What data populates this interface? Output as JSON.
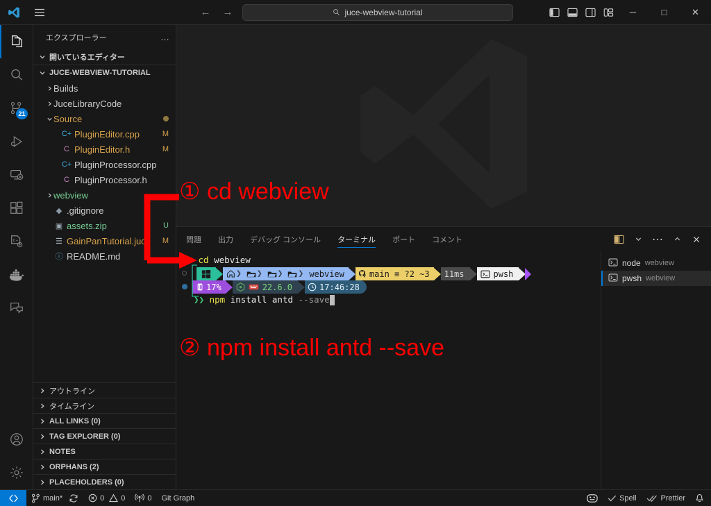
{
  "titlebar": {
    "logo_icon": "vscode-logo",
    "menu_icon": "hamburger-menu-icon",
    "back_icon": "←",
    "forward_icon": "→",
    "search_placeholder": "juce-webview-tutorial",
    "search_value": "juce-webview-tutorial",
    "search_icon": "search-icon",
    "layout_icons": [
      "toggle-primary-sidebar-icon",
      "toggle-panel-icon",
      "toggle-secondary-sidebar-icon",
      "customize-layout-icon"
    ],
    "minimize": "─",
    "maximize": "□",
    "close": "✕"
  },
  "activitybar": {
    "items": [
      {
        "name": "explorer",
        "icon": "files-icon",
        "active": true,
        "badge": ""
      },
      {
        "name": "search",
        "icon": "search-icon",
        "active": false,
        "badge": ""
      },
      {
        "name": "source-control",
        "icon": "source-control-icon",
        "active": false,
        "badge": "21"
      },
      {
        "name": "run-and-debug",
        "icon": "run-debug-icon",
        "active": false,
        "badge": ""
      },
      {
        "name": "remote-explorer",
        "icon": "remote-explorer-icon",
        "active": false,
        "badge": ""
      },
      {
        "name": "extensions",
        "icon": "extensions-icon",
        "active": false,
        "badge": ""
      },
      {
        "name": "cpp-config",
        "icon": "cpp-gear-icon",
        "active": false,
        "badge": ""
      },
      {
        "name": "docker",
        "icon": "docker-whale-icon",
        "active": false,
        "badge": ""
      },
      {
        "name": "chat",
        "icon": "chat-bubble-icon",
        "active": false,
        "badge": ""
      }
    ],
    "bottom": [
      {
        "name": "accounts",
        "icon": "account-icon"
      },
      {
        "name": "settings",
        "icon": "gear-icon"
      }
    ]
  },
  "sidebar": {
    "title": "エクスプローラー",
    "more_actions": "…",
    "open_editors_label": "開いているエディター",
    "project_label": "JUCE-WEBVIEW-TUTORIAL",
    "tree": [
      {
        "label": "Builds",
        "type": "folder",
        "expanded": false,
        "indent": 1,
        "badge": "",
        "icon": "",
        "color": "#cccccc"
      },
      {
        "label": "JuceLibraryCode",
        "type": "folder",
        "expanded": false,
        "indent": 1,
        "badge": "",
        "icon": "",
        "color": "#cccccc"
      },
      {
        "label": "Source",
        "type": "folder",
        "expanded": true,
        "indent": 1,
        "badge": "dot",
        "icon": "",
        "color": "#d6a24a"
      },
      {
        "label": "PluginEditor.cpp",
        "type": "file",
        "expanded": false,
        "indent": 2,
        "badge": "M",
        "icon": "C+",
        "color": "#d6a24a",
        "iconcolor": "#38b1e0"
      },
      {
        "label": "PluginEditor.h",
        "type": "file",
        "expanded": false,
        "indent": 2,
        "badge": "M",
        "icon": "C",
        "color": "#d6a24a",
        "iconcolor": "#c586c0"
      },
      {
        "label": "PluginProcessor.cpp",
        "type": "file",
        "expanded": false,
        "indent": 2,
        "badge": "",
        "icon": "C+",
        "color": "#cccccc",
        "iconcolor": "#38b1e0"
      },
      {
        "label": "PluginProcessor.h",
        "type": "file",
        "expanded": false,
        "indent": 2,
        "badge": "",
        "icon": "C",
        "color": "#cccccc",
        "iconcolor": "#c586c0"
      },
      {
        "label": "webview",
        "type": "folder",
        "expanded": false,
        "indent": 1,
        "badge": "",
        "icon": "",
        "color": "#73c991"
      },
      {
        "label": ".gitignore",
        "type": "file",
        "expanded": false,
        "indent": 1,
        "badge": "",
        "icon": "◆",
        "color": "#cccccc",
        "iconcolor": "#8a9aa9"
      },
      {
        "label": "assets.zip",
        "type": "file",
        "expanded": false,
        "indent": 1,
        "badge": "U",
        "icon": "▣",
        "color": "#73c991",
        "iconcolor": "#9aa7b0"
      },
      {
        "label": "GainPanTutorial.juce",
        "type": "file",
        "expanded": false,
        "indent": 1,
        "badge": "M",
        "icon": "☰",
        "color": "#d6a24a",
        "iconcolor": "#a9b5bf"
      },
      {
        "label": "README.md",
        "type": "file",
        "expanded": false,
        "indent": 1,
        "badge": "",
        "icon": "ⓘ",
        "color": "#cccccc",
        "iconcolor": "#519aba"
      }
    ],
    "bottom_sections": [
      {
        "label": "アウトライン",
        "bold": false
      },
      {
        "label": "タイムライン",
        "bold": false
      },
      {
        "label": "ALL LINKS (0)",
        "bold": true
      },
      {
        "label": "TAG EXPLORER (0)",
        "bold": true
      },
      {
        "label": "NOTES",
        "bold": true
      },
      {
        "label": "ORPHANS (2)",
        "bold": true
      },
      {
        "label": "PLACEHOLDERS (0)",
        "bold": true
      }
    ]
  },
  "panel": {
    "tabs": [
      {
        "label": "問題",
        "active": false
      },
      {
        "label": "出力",
        "active": false
      },
      {
        "label": "デバッグ コンソール",
        "active": false
      },
      {
        "label": "ターミナル",
        "active": true
      },
      {
        "label": "ポート",
        "active": false
      },
      {
        "label": "コメント",
        "active": false
      }
    ],
    "actions": [
      {
        "name": "split-terminal-icon",
        "glyph": "split"
      },
      {
        "name": "chevron-down-icon",
        "glyph": "∨"
      },
      {
        "name": "panel-more-actions-icon",
        "glyph": "⋯"
      },
      {
        "name": "maximize-panel-icon",
        "glyph": "∧"
      },
      {
        "name": "close-panel-icon",
        "glyph": "✕"
      }
    ]
  },
  "terminal": {
    "command_line": {
      "caret": "❯",
      "command": "cd",
      "argument": "webview"
    },
    "prompt_row1": [
      {
        "name": "os-segment",
        "text": "",
        "icon": "windows-logo-icon",
        "style": "seg-teal"
      },
      {
        "name": "path-home",
        "text": "",
        "icon": "home-icon",
        "style": "seg-blue"
      },
      {
        "name": "path-folder-1",
        "text": "",
        "icon": "folder-icon",
        "style": "seg-blue"
      },
      {
        "name": "path-folder-2",
        "text": "",
        "icon": "folder-icon",
        "style": "seg-blue"
      },
      {
        "name": "path-folder-3",
        "text": "",
        "icon": "folder-icon",
        "style": "seg-blue"
      },
      {
        "name": "path-current",
        "text": "webview",
        "icon": "",
        "style": "seg-blue"
      },
      {
        "name": "git-branch-segment",
        "text": "main ≡ ?2 ~3",
        "icon": "git-icon",
        "style": "seg-yellow"
      },
      {
        "name": "duration-segment",
        "text": "11ms",
        "icon": "",
        "style": "seg-grey"
      },
      {
        "name": "shell-segment",
        "text": "pwsh",
        "icon": "terminal-icon",
        "style": "seg-white"
      }
    ],
    "prompt_row2": [
      {
        "name": "cpu-segment",
        "text": "17%",
        "icon": "cpu-icon",
        "style": "seg-purple"
      },
      {
        "name": "node-version-segment",
        "text": "22.6.0",
        "icon": "node-icon",
        "style": "seg-dark"
      },
      {
        "name": "clock-segment",
        "text": "17:46:28",
        "icon": "clock-icon",
        "style": "seg-darkblue"
      }
    ],
    "input_line": {
      "arrow": "❯❯",
      "command": "npm",
      "args": "install antd",
      "flag": "--save"
    },
    "terminal_list": [
      {
        "name": "node",
        "description": "webview",
        "icon": "terminal-icon",
        "selected": false
      },
      {
        "name": "pwsh",
        "description": "webview",
        "icon": "terminal-icon",
        "selected": true
      }
    ]
  },
  "statusbar": {
    "remote_icon": "remote-window-icon",
    "left": [
      {
        "name": "git-branch",
        "icon": "branch-icon",
        "text": "main*"
      },
      {
        "name": "sync-changes",
        "icon": "sync-icon",
        "text": ""
      },
      {
        "name": "problems",
        "icon": "error-warning-icon",
        "text": "0",
        "text2": "0"
      },
      {
        "name": "ports",
        "icon": "radio-tower-icon",
        "text": "0"
      },
      {
        "name": "git-graph",
        "icon": "",
        "text": "Git Graph"
      }
    ],
    "right": [
      {
        "name": "port-forward",
        "icon": "port-forward-icon",
        "text": ""
      },
      {
        "name": "spell-checker",
        "icon": "check-icon",
        "text": "Spell"
      },
      {
        "name": "prettier",
        "icon": "double-check-icon",
        "text": "Prettier"
      },
      {
        "name": "notifications",
        "icon": "bell-icon",
        "text": ""
      }
    ]
  },
  "annotations": [
    {
      "name": "annotation-step-1",
      "number": "①",
      "text": "cd webview"
    },
    {
      "name": "annotation-step-2",
      "number": "②",
      "text": "npm install antd --save"
    }
  ],
  "colors": {
    "accent": "#0078d4",
    "annotation_red": "#ff0000",
    "modified_badge": "#d6a24a",
    "untracked_badge": "#73c991"
  }
}
